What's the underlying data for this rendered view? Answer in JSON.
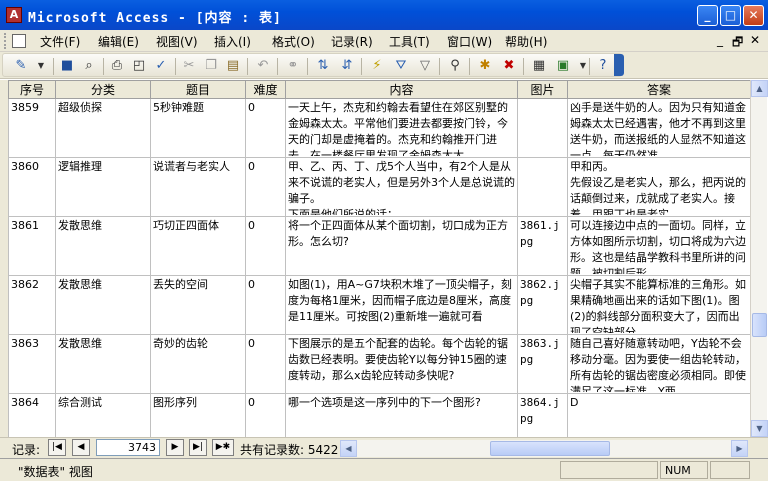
{
  "window": {
    "title": "Microsoft Access - [内容 : 表]",
    "app_icon": "access-key-icon",
    "minimize": "_",
    "maximize": "□",
    "close": "✕"
  },
  "menu": {
    "items": [
      "文件(F)",
      "编辑(E)",
      "视图(V)",
      "插入(I)",
      "格式(O)",
      "记录(R)",
      "工具(T)",
      "窗口(W)",
      "帮助(H)"
    ],
    "mdi_controls": [
      "_",
      "🗗",
      "✕"
    ]
  },
  "toolbar": {
    "icons": [
      "view-icon",
      "save-icon",
      "search-icon",
      "print-icon",
      "print-preview-icon",
      "spelling-icon",
      "cut-icon",
      "copy-icon",
      "paste-icon",
      "undo-icon",
      "hyperlink-icon",
      "sort-ascending-icon",
      "sort-descending-icon",
      "filter-by-selection-icon",
      "filter-by-form-icon",
      "apply-filter-icon",
      "find-icon",
      "new-record-icon",
      "delete-record-icon",
      "properties-icon",
      "database-window-icon",
      "help-icon"
    ]
  },
  "grid": {
    "columns": [
      "序号",
      "分类",
      "题目",
      "难度",
      "内容",
      "图片",
      "答案"
    ],
    "rows": [
      {
        "id": "3859",
        "category": "超级侦探",
        "title": "5秒钟难题",
        "difficulty": "0",
        "content": "一天上午，杰克和约翰去看望住在郊区别墅的金姆森太太。平常他们要进去都要按门铃，今天的门却是虚掩着的。杰克和约翰推开门进去，在一楼餐厅里发现了金姆森太太",
        "image": "",
        "answer": "凶手是送牛奶的人。因为只有知道金姆森太太已经遇害，他才不再到这里送牛奶，而送报纸的人显然不知道这一点，每天仍然准"
      },
      {
        "id": "3860",
        "category": "逻辑推理",
        "title": "说谎者与老实人",
        "difficulty": "0",
        "content": "甲、乙、丙、丁、戊5个人当中，有2个人是从来不说谎的老实人，但是另外3个人是总说谎的骗子。\n下面是他们所说的话：",
        "image": "",
        "answer": "甲和丙。\n先假设乙是老实人，那么，把丙说的话颠倒过来，戊就成了老实人。接着，甲跟丁也是老实"
      },
      {
        "id": "3861",
        "category": "发散思维",
        "title": "巧切正四面体",
        "difficulty": "0",
        "content": "将一个正四面体从某个面切割，切口成为正方形。怎么切?",
        "image": "3861.jpg",
        "answer": "可以连接边中点的一面切。同样，立方体如图所示切割，切口将成为六边形。这也是结晶学教科书里所讲的问题，被切割后形"
      },
      {
        "id": "3862",
        "category": "发散思维",
        "title": "丢失的空间",
        "difficulty": "0",
        "content": "如图(1)，用A~G7块积木堆了一顶尖帽子，刻度为每格1厘米，因而帽子底边是8厘米，高度是11厘米。可按图(2)重新堆一遍就可看",
        "image": "3862.jpg",
        "answer": "尖帽子其实不能算标准的三角形。如果精确地画出来的话如下图(1)。图(2)的斜线部分面积变大了，因而出现了空缺部分。"
      },
      {
        "id": "3863",
        "category": "发散思维",
        "title": "奇妙的齿轮",
        "difficulty": "0",
        "content": "下图展示的是五个配套的齿轮。每个齿轮的锯齿数已经表明。要使齿轮Y以每分钟15圈的速度转动，那么x齿轮应转动多快呢?",
        "image": "3863.jpg",
        "answer": "随自己喜好随意转动吧，Y齿轮不会移动分毫。因为要使一组齿轮转动，所有齿轮的锯齿密度必须相同。即使满足了这一标准，Y两"
      },
      {
        "id": "3864",
        "category": "综合测试",
        "title": "图形序列",
        "difficulty": "0",
        "content": "哪一个选项是这一序列中的下一个图形?",
        "image": "3864.jpg",
        "answer": "D"
      }
    ]
  },
  "navigation": {
    "label": "记录:",
    "current_record": "3743",
    "total": "共有记录数: 5422",
    "buttons": [
      "first-record",
      "previous-record",
      "next-record",
      "last-record",
      "new-record"
    ]
  },
  "status": {
    "view": "\"数据表\" 视图",
    "num": "NUM"
  }
}
